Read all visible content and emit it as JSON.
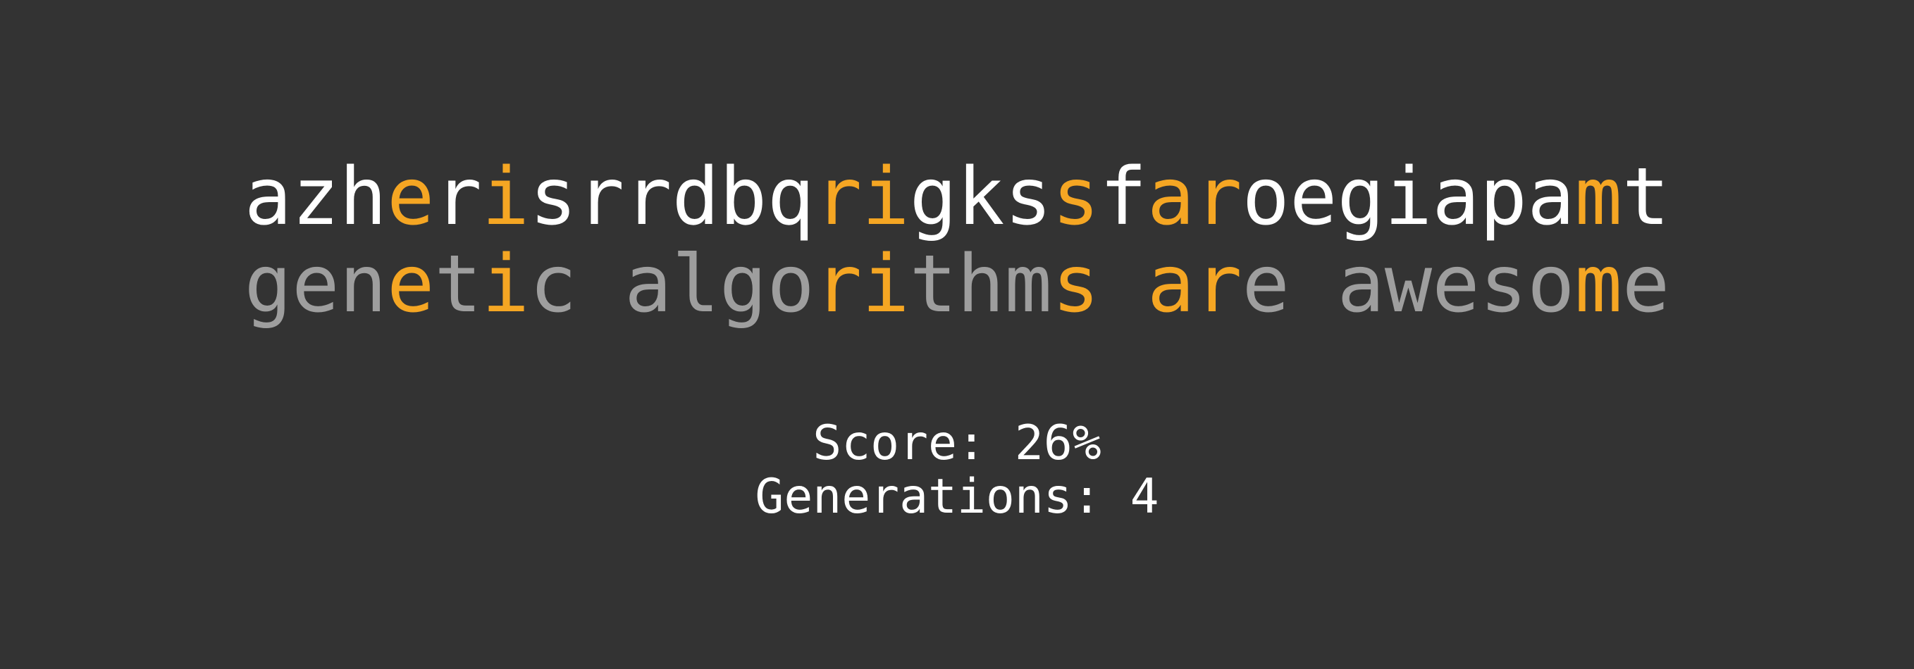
{
  "candidate": "azherisrrdbqrigkssfaroegiapamt",
  "target": "genetic algorithms are awesome",
  "colors": {
    "background": "#333333",
    "candidate_text": "#ffffff",
    "target_text": "#9e9e9e",
    "match_highlight": "#f5a623"
  },
  "stats": {
    "score_label": "Score:",
    "score_value": "26%",
    "generations_label": "Generations:",
    "generations_value": "4"
  }
}
